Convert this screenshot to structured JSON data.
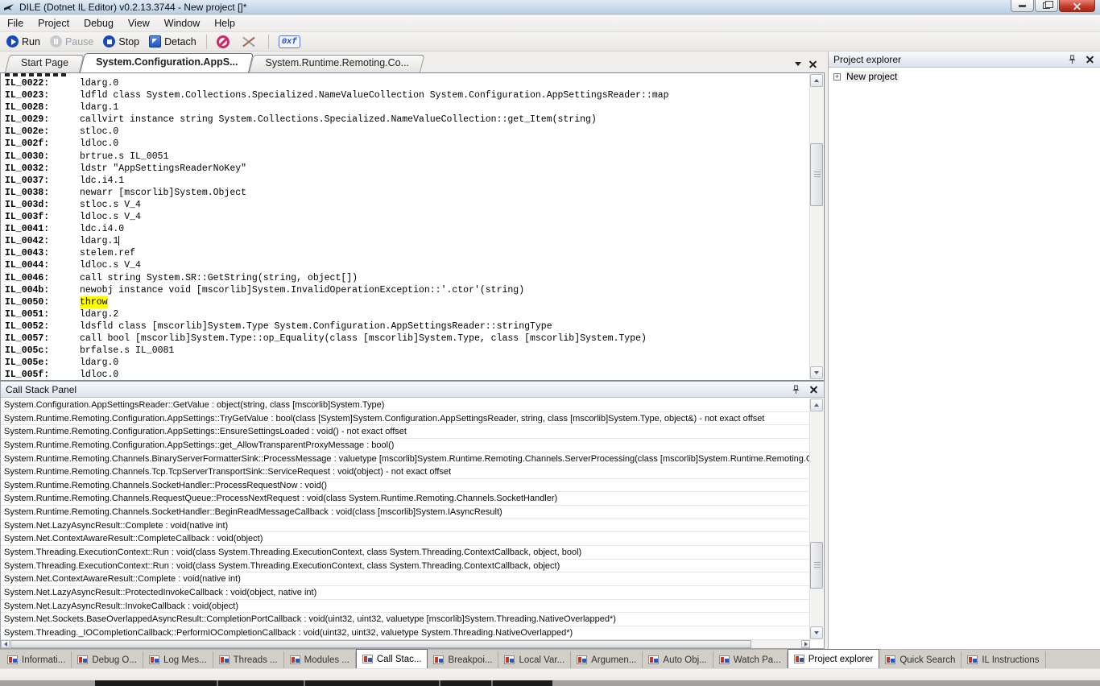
{
  "window": {
    "title": "DILE (Dotnet IL Editor) v0.2.13.3744 - New project []*"
  },
  "colors": {
    "highlight": "#ffff00"
  },
  "menu": {
    "items": [
      "File",
      "Project",
      "Debug",
      "View",
      "Window",
      "Help"
    ]
  },
  "toolbar": {
    "run": "Run",
    "pause": "Pause",
    "stop": "Stop",
    "detach": "Detach",
    "hex_badge": "0xf"
  },
  "editor_tabs": [
    {
      "label": "Start Page",
      "active": false
    },
    {
      "label": "System.Configuration.AppS...",
      "active": true
    },
    {
      "label": "System.Runtime.Remoting.Co...",
      "active": false
    }
  ],
  "code": {
    "lines": [
      {
        "offset": "IL_0022:",
        "text": "ldarg.0"
      },
      {
        "offset": "IL_0023:",
        "text": "ldfld class System.Collections.Specialized.NameValueCollection System.Configuration.AppSettingsReader::map"
      },
      {
        "offset": "IL_0028:",
        "text": "ldarg.1"
      },
      {
        "offset": "IL_0029:",
        "text": "callvirt instance string System.Collections.Specialized.NameValueCollection::get_Item(string)"
      },
      {
        "offset": "IL_002e:",
        "text": "stloc.0"
      },
      {
        "offset": "IL_002f:",
        "text": "ldloc.0"
      },
      {
        "offset": "IL_0030:",
        "text": "brtrue.s IL_0051"
      },
      {
        "offset": "IL_0032:",
        "text": "ldstr \"AppSettingsReaderNoKey\""
      },
      {
        "offset": "IL_0037:",
        "text": "ldc.i4.1"
      },
      {
        "offset": "IL_0038:",
        "text": "newarr [mscorlib]System.Object"
      },
      {
        "offset": "IL_003d:",
        "text": "stloc.s V_4"
      },
      {
        "offset": "IL_003f:",
        "text": "ldloc.s V_4"
      },
      {
        "offset": "IL_0041:",
        "text": "ldc.i4.0"
      },
      {
        "offset": "IL_0042:",
        "text": "ldarg.1",
        "caret": true
      },
      {
        "offset": "IL_0043:",
        "text": "stelem.ref"
      },
      {
        "offset": "IL_0044:",
        "text": "ldloc.s V_4"
      },
      {
        "offset": "IL_0046:",
        "text": "call string System.SR::GetString(string, object[])"
      },
      {
        "offset": "IL_004b:",
        "text": "newobj instance void [mscorlib]System.InvalidOperationException::'.ctor'(string)"
      },
      {
        "offset": "IL_0050:",
        "text": "throw",
        "highlight": true
      },
      {
        "offset": "IL_0051:",
        "text": "ldarg.2"
      },
      {
        "offset": "IL_0052:",
        "text": "ldsfld class [mscorlib]System.Type System.Configuration.AppSettingsReader::stringType"
      },
      {
        "offset": "IL_0057:",
        "text": "call bool [mscorlib]System.Type::op_Equality(class [mscorlib]System.Type, class [mscorlib]System.Type)"
      },
      {
        "offset": "IL_005c:",
        "text": "brfalse.s IL_0081"
      },
      {
        "offset": "IL_005e:",
        "text": "ldarg.0"
      },
      {
        "offset": "IL_005f:",
        "text": "ldloc.0"
      }
    ]
  },
  "callstack": {
    "title": "Call Stack Panel",
    "frames": [
      "System.Configuration.AppSettingsReader::GetValue : object(string, class [mscorlib]System.Type)",
      "System.Runtime.Remoting.Configuration.AppSettings::TryGetValue : bool(class [System]System.Configuration.AppSettingsReader, string, class [mscorlib]System.Type, object&) - not exact offset",
      "System.Runtime.Remoting.Configuration.AppSettings::EnsureSettingsLoaded : void() - not exact offset",
      "System.Runtime.Remoting.Configuration.AppSettings::get_AllowTransparentProxyMessage : bool()",
      "System.Runtime.Remoting.Channels.BinaryServerFormatterSink::ProcessMessage : valuetype [mscorlib]System.Runtime.Remoting.Channels.ServerProcessing(class [mscorlib]System.Runtime.Remoting.Ch...",
      "System.Runtime.Remoting.Channels.Tcp.TcpServerTransportSink::ServiceRequest : void(object) - not exact offset",
      "System.Runtime.Remoting.Channels.SocketHandler::ProcessRequestNow : void()",
      "System.Runtime.Remoting.Channels.RequestQueue::ProcessNextRequest : void(class System.Runtime.Remoting.Channels.SocketHandler)",
      "System.Runtime.Remoting.Channels.SocketHandler::BeginReadMessageCallback : void(class [mscorlib]System.IAsyncResult)",
      "System.Net.LazyAsyncResult::Complete : void(native int)",
      "System.Net.ContextAwareResult::CompleteCallback : void(object)",
      "System.Threading.ExecutionContext::Run : void(class System.Threading.ExecutionContext, class System.Threading.ContextCallback, object, bool)",
      "System.Threading.ExecutionContext::Run : void(class System.Threading.ExecutionContext, class System.Threading.ContextCallback, object)",
      "System.Net.ContextAwareResult::Complete : void(native int)",
      "System.Net.LazyAsyncResult::ProtectedInvokeCallback : void(object, native int)",
      "System.Net.LazyAsyncResult::InvokeCallback : void(object)",
      "System.Net.Sockets.BaseOverlappedAsyncResult::CompletionPortCallback : void(uint32, uint32, valuetype [mscorlib]System.Threading.NativeOverlapped*)",
      "System.Threading._IOCompletionCallback::PerformIOCompletionCallback : void(uint32, uint32, valuetype System.Threading.NativeOverlapped*)"
    ]
  },
  "project_explorer": {
    "title": "Project explorer",
    "items": [
      {
        "expander": "+",
        "label": "New project"
      }
    ]
  },
  "bottom_tabs": [
    {
      "label": "Informati...",
      "active": false
    },
    {
      "label": "Debug O...",
      "active": false
    },
    {
      "label": "Log Mes...",
      "active": false
    },
    {
      "label": "Threads ...",
      "active": false
    },
    {
      "label": "Modules ...",
      "active": false
    },
    {
      "label": "Call Stac...",
      "active": true
    },
    {
      "label": "Breakpoi...",
      "active": false
    },
    {
      "label": "Local Var...",
      "active": false
    },
    {
      "label": "Argumen...",
      "active": false
    },
    {
      "label": "Auto Obj...",
      "active": false
    },
    {
      "label": "Watch Pa...",
      "active": false
    },
    {
      "label": "Project explorer",
      "active": true
    },
    {
      "label": "Quick Search",
      "active": false
    },
    {
      "label": "IL Instructions",
      "active": false
    }
  ]
}
